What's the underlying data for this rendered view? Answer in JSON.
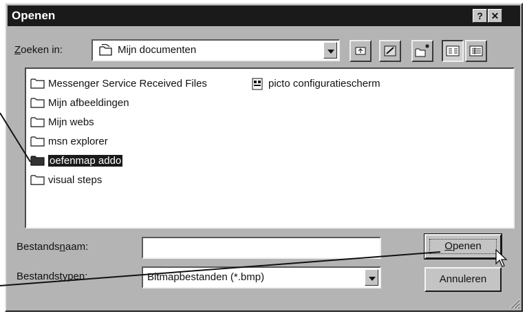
{
  "window": {
    "title": "Openen"
  },
  "title_buttons": {
    "help": "?",
    "close": "✕"
  },
  "lookin": {
    "label_prefix": "Z",
    "label_rest": "oeken in:",
    "value": "Mijn documenten"
  },
  "toolbar": [
    {
      "name": "up-one-level-icon"
    },
    {
      "name": "desktop-icon"
    },
    {
      "name": "new-folder-icon"
    },
    {
      "name": "list-view-icon",
      "pressed": true
    },
    {
      "name": "details-view-icon"
    }
  ],
  "files": [
    {
      "label": "Messenger Service Received Files",
      "type": "folder"
    },
    {
      "label": "Mijn afbeeldingen",
      "type": "folder"
    },
    {
      "label": "Mijn webs",
      "type": "folder"
    },
    {
      "label": "msn explorer",
      "type": "folder"
    },
    {
      "label": "oefenmap addo",
      "type": "folder",
      "selected": true
    },
    {
      "label": "visual steps",
      "type": "folder"
    },
    {
      "label": "picto configuratiescherm",
      "type": "bitmap"
    }
  ],
  "filename": {
    "label_a": "Bestands",
    "label_u": "n",
    "label_b": "aam:",
    "value": ""
  },
  "filetype": {
    "label_a": "Bestands",
    "label_u": "t",
    "label_b": "ypen:",
    "value": "Bitmapbestanden (*.bmp)"
  },
  "buttons": {
    "open_u": "O",
    "open_rest": "penen",
    "cancel": "Annuleren"
  }
}
